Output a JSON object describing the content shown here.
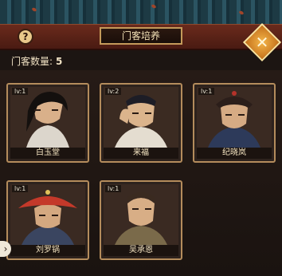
{
  "header": {
    "title": "门客培养",
    "help_icon": "question-mark-icon",
    "close_icon": "close-x-icon"
  },
  "summary": {
    "count_label": "门客数量:",
    "count_value": "5"
  },
  "retainers": [
    {
      "level": "lv:1",
      "name": "白玉堂"
    },
    {
      "level": "lv:2",
      "name": "来福"
    },
    {
      "level": "lv:1",
      "name": "纪晓岚"
    },
    {
      "level": "lv:1",
      "name": "刘罗锅"
    },
    {
      "level": "lv:1",
      "name": "吴承恩"
    }
  ],
  "side_nav": {
    "icon": "chevron-right-icon"
  },
  "colors": {
    "frame_gold": "#b48c5c",
    "header_red": "#6a2a1c",
    "roof_teal": "#2b5462"
  }
}
